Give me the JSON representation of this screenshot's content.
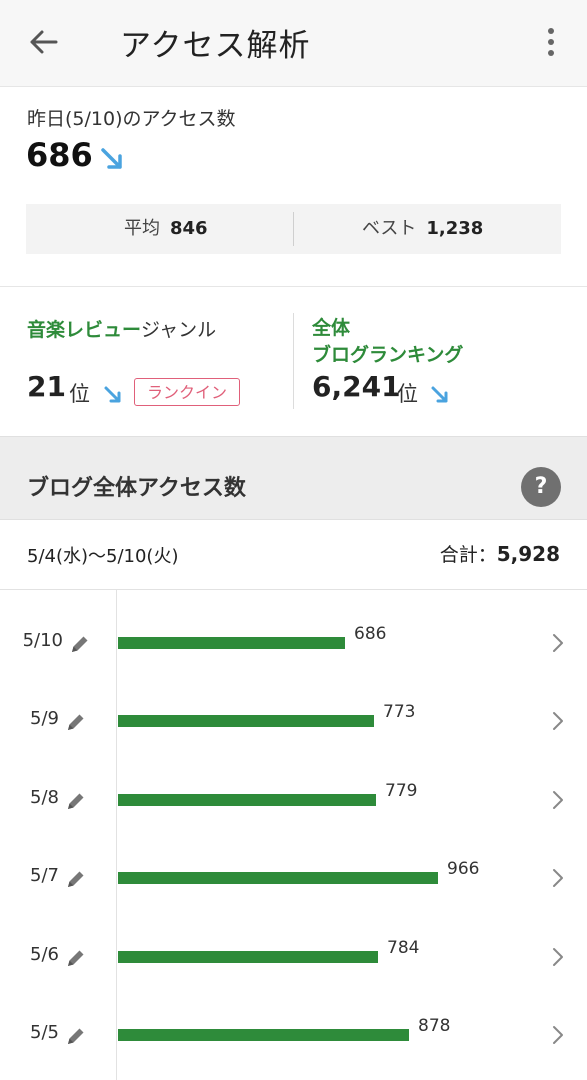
{
  "header": {
    "title": "アクセス解析"
  },
  "yesterday": {
    "label": "昨日(5/10)のアクセス数",
    "value": "686"
  },
  "stats": {
    "avg_label": "平均",
    "avg_value": "846",
    "best_label": "ベスト",
    "best_value": "1,238"
  },
  "genre": {
    "label_green": "音楽レビュー",
    "label_rest": "ジャンル",
    "rank": "21",
    "unit": "位",
    "badge": "ランクイン"
  },
  "overall": {
    "line1": "全体",
    "line2": "ブログランキング",
    "rank": "6,241",
    "unit": "位"
  },
  "section": {
    "title": "ブログ全体アクセス数",
    "help": "?"
  },
  "range": {
    "label": "5/4(水)〜5/10(火)",
    "total_label": "合計：",
    "total_value": "5,928"
  },
  "colors": {
    "bar": "#2e8b3a",
    "accent_green": "#2e8b3a",
    "arrow_blue": "#4aa3df",
    "badge_pink": "#e0607a"
  },
  "chart_data": {
    "type": "bar",
    "orientation": "horizontal",
    "categories": [
      "5/10",
      "5/9",
      "5/8",
      "5/7",
      "5/6",
      "5/5"
    ],
    "values": [
      686,
      773,
      779,
      966,
      784,
      878
    ],
    "xlim": [
      0,
      1000
    ]
  }
}
